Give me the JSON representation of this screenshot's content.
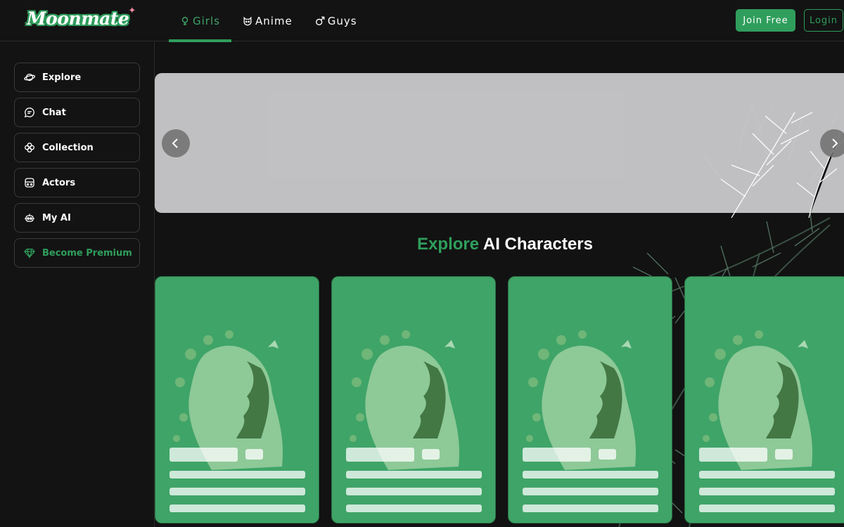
{
  "brand": {
    "name": "Moonmate"
  },
  "header": {
    "tabs": [
      {
        "label": "Girls",
        "icon": "female-icon",
        "active": true
      },
      {
        "label": "Anime",
        "icon": "cat-icon",
        "active": false
      },
      {
        "label": "Guys",
        "icon": "male-icon",
        "active": false
      }
    ],
    "join_label": "Join Free",
    "login_label": "Login"
  },
  "sidebar": {
    "items": [
      {
        "label": "Explore",
        "icon": "planet-icon"
      },
      {
        "label": "Chat",
        "icon": "chat-bubble-icon"
      },
      {
        "label": "Collection",
        "icon": "clover-icon"
      },
      {
        "label": "Actors",
        "icon": "actor-icon"
      },
      {
        "label": "My AI",
        "icon": "robot-icon"
      },
      {
        "label": "Become Premium",
        "icon": "diamond-icon"
      }
    ]
  },
  "main": {
    "title_accent": "Explore",
    "title_rest": "AI Characters",
    "cards_count": 4
  },
  "colors": {
    "accent": "#2f9e5c",
    "card_bg": "#3fa468",
    "background": "#121212",
    "banner": "#c8c8ca"
  }
}
